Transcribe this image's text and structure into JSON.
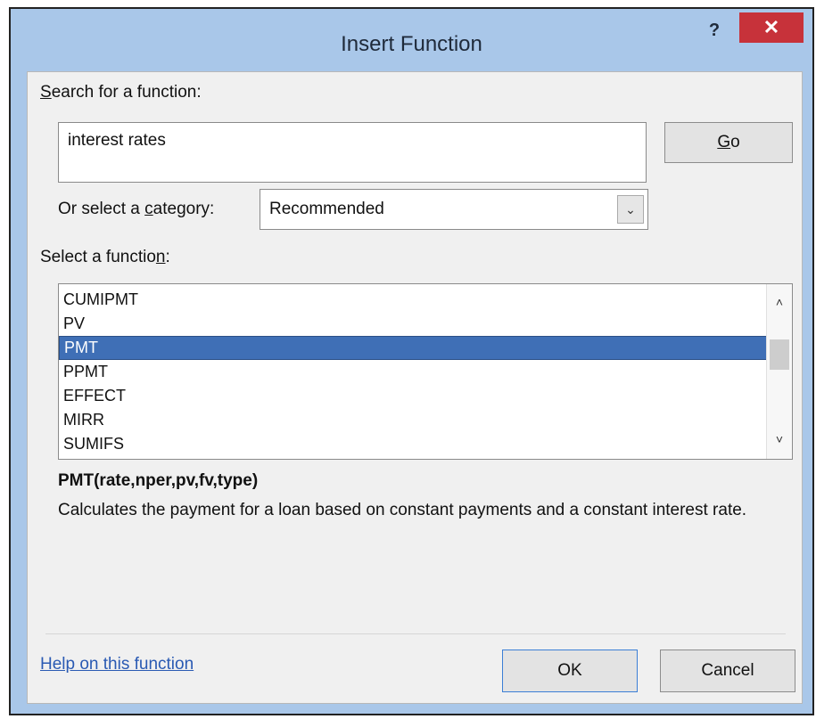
{
  "window": {
    "title": "Insert Function",
    "help_glyph": "?",
    "close_glyph": "✕"
  },
  "search": {
    "label_pre": "",
    "label_accel": "S",
    "label_post": "earch for a function:",
    "value": "interest rates",
    "go_pre": "",
    "go_accel": "G",
    "go_post": "o"
  },
  "category": {
    "label_pre": "Or select a ",
    "label_accel": "c",
    "label_post": "ategory:",
    "value": "Recommended",
    "arrow_glyph": "⌄"
  },
  "functions": {
    "label_pre": "Select a functio",
    "label_accel": "n",
    "label_post": ":",
    "items": [
      "CUMIPMT",
      "PV",
      "PMT",
      "PPMT",
      "EFFECT",
      "MIRR",
      "SUMIFS"
    ],
    "selected": "PMT",
    "scroll_up_glyph": "˄",
    "scroll_down_glyph": "˅"
  },
  "details": {
    "syntax": "PMT(rate,nper,pv,fv,type)",
    "description": "Calculates the payment for a loan based on constant payments and a constant interest rate."
  },
  "footer": {
    "help_link": "Help on this function",
    "ok_label": "OK",
    "cancel_label": "Cancel"
  },
  "colors": {
    "frame": "#a9c7e9",
    "close": "#c7323a",
    "selection": "#3f6fb6",
    "link": "#2a5ab3"
  }
}
